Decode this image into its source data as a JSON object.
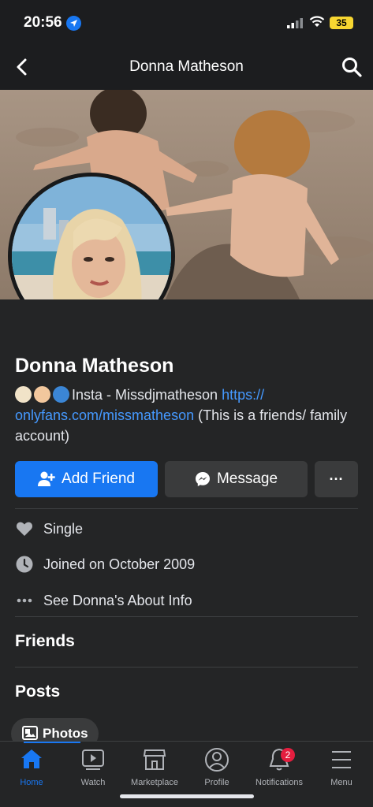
{
  "status_bar": {
    "time": "20:56",
    "battery": "35"
  },
  "nav": {
    "title": "Donna Matheson"
  },
  "profile": {
    "name": "Donna Matheson",
    "bio_text": "Insta - Missdjmatheson ",
    "bio_link": "https://​onlyfans.com/missmatheson",
    "bio_suffix": " (This is a friends/ family account)"
  },
  "actions": {
    "add_friend": "Add Friend",
    "message": "Message",
    "more": "···"
  },
  "info": {
    "relationship": "Single",
    "joined": "Joined on October 2009",
    "about": "See Donna's About Info"
  },
  "sections": {
    "friends": "Friends",
    "posts": "Posts"
  },
  "chips": {
    "photos": "Photos"
  },
  "tabs": [
    {
      "label": "Home"
    },
    {
      "label": "Watch"
    },
    {
      "label": "Marketplace"
    },
    {
      "label": "Profile"
    },
    {
      "label": "Notifications",
      "badge": "2"
    },
    {
      "label": "Menu"
    }
  ],
  "colors": {
    "accent": "#1877f2",
    "link": "#4599ff",
    "background": "#242526",
    "badge": "#e41e3f"
  }
}
